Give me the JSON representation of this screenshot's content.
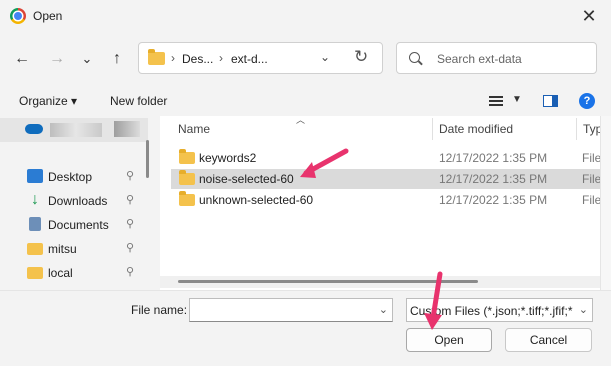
{
  "window": {
    "title": "Open",
    "close_glyph": "✕",
    "app_icon": "chrome-icon"
  },
  "nav": {
    "back": "←",
    "forward": "→",
    "recent": "⌄",
    "up": "↑"
  },
  "address": {
    "crumbs": [
      "Des...",
      "ext-d..."
    ],
    "separator": "›",
    "dropdown": "⌄",
    "refresh": "↻"
  },
  "search": {
    "placeholder": "Search ext-data"
  },
  "toolbar": {
    "organize": "Organize ▾",
    "new_folder": "New folder",
    "help": "?"
  },
  "sidebar": {
    "items": [
      {
        "label": "Desktop",
        "icon": "desktop-icon"
      },
      {
        "label": "Downloads",
        "icon": "download-icon"
      },
      {
        "label": "Documents",
        "icon": "documents-icon"
      },
      {
        "label": "mitsu",
        "icon": "folder-icon"
      },
      {
        "label": "local",
        "icon": "folder-icon"
      }
    ],
    "pin": "📌"
  },
  "columns": {
    "name": "Name",
    "date": "Date modified",
    "type": "Type"
  },
  "files": [
    {
      "name": "keywords2",
      "date": "12/17/2022 1:35 PM",
      "type": "File fo",
      "selected": false
    },
    {
      "name": "noise-selected-60",
      "date": "12/17/2022 1:35 PM",
      "type": "File fo",
      "selected": true
    },
    {
      "name": "unknown-selected-60",
      "date": "12/17/2022 1:35 PM",
      "type": "File fo",
      "selected": false
    }
  ],
  "footer": {
    "file_name_label": "File name:",
    "file_name_value": "",
    "filter": "Custom Files (*.json;*.tiff;*.jfif;*",
    "open": "Open",
    "cancel": "Cancel"
  },
  "colors": {
    "annotation_arrow": "#e8336d",
    "accent": "#1a73e8",
    "folder": "#f4c24c"
  }
}
